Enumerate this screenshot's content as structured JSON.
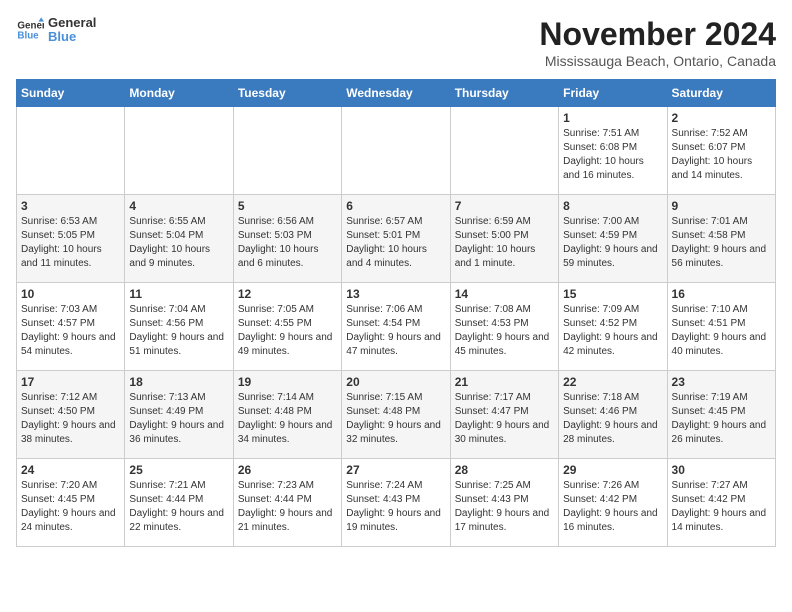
{
  "header": {
    "logo_line1": "General",
    "logo_line2": "Blue",
    "month": "November 2024",
    "location": "Mississauga Beach, Ontario, Canada"
  },
  "days_of_week": [
    "Sunday",
    "Monday",
    "Tuesday",
    "Wednesday",
    "Thursday",
    "Friday",
    "Saturday"
  ],
  "weeks": [
    [
      {
        "day": "",
        "info": ""
      },
      {
        "day": "",
        "info": ""
      },
      {
        "day": "",
        "info": ""
      },
      {
        "day": "",
        "info": ""
      },
      {
        "day": "",
        "info": ""
      },
      {
        "day": "1",
        "info": "Sunrise: 7:51 AM\nSunset: 6:08 PM\nDaylight: 10 hours and 16 minutes."
      },
      {
        "day": "2",
        "info": "Sunrise: 7:52 AM\nSunset: 6:07 PM\nDaylight: 10 hours and 14 minutes."
      }
    ],
    [
      {
        "day": "3",
        "info": "Sunrise: 6:53 AM\nSunset: 5:05 PM\nDaylight: 10 hours and 11 minutes."
      },
      {
        "day": "4",
        "info": "Sunrise: 6:55 AM\nSunset: 5:04 PM\nDaylight: 10 hours and 9 minutes."
      },
      {
        "day": "5",
        "info": "Sunrise: 6:56 AM\nSunset: 5:03 PM\nDaylight: 10 hours and 6 minutes."
      },
      {
        "day": "6",
        "info": "Sunrise: 6:57 AM\nSunset: 5:01 PM\nDaylight: 10 hours and 4 minutes."
      },
      {
        "day": "7",
        "info": "Sunrise: 6:59 AM\nSunset: 5:00 PM\nDaylight: 10 hours and 1 minute."
      },
      {
        "day": "8",
        "info": "Sunrise: 7:00 AM\nSunset: 4:59 PM\nDaylight: 9 hours and 59 minutes."
      },
      {
        "day": "9",
        "info": "Sunrise: 7:01 AM\nSunset: 4:58 PM\nDaylight: 9 hours and 56 minutes."
      }
    ],
    [
      {
        "day": "10",
        "info": "Sunrise: 7:03 AM\nSunset: 4:57 PM\nDaylight: 9 hours and 54 minutes."
      },
      {
        "day": "11",
        "info": "Sunrise: 7:04 AM\nSunset: 4:56 PM\nDaylight: 9 hours and 51 minutes."
      },
      {
        "day": "12",
        "info": "Sunrise: 7:05 AM\nSunset: 4:55 PM\nDaylight: 9 hours and 49 minutes."
      },
      {
        "day": "13",
        "info": "Sunrise: 7:06 AM\nSunset: 4:54 PM\nDaylight: 9 hours and 47 minutes."
      },
      {
        "day": "14",
        "info": "Sunrise: 7:08 AM\nSunset: 4:53 PM\nDaylight: 9 hours and 45 minutes."
      },
      {
        "day": "15",
        "info": "Sunrise: 7:09 AM\nSunset: 4:52 PM\nDaylight: 9 hours and 42 minutes."
      },
      {
        "day": "16",
        "info": "Sunrise: 7:10 AM\nSunset: 4:51 PM\nDaylight: 9 hours and 40 minutes."
      }
    ],
    [
      {
        "day": "17",
        "info": "Sunrise: 7:12 AM\nSunset: 4:50 PM\nDaylight: 9 hours and 38 minutes."
      },
      {
        "day": "18",
        "info": "Sunrise: 7:13 AM\nSunset: 4:49 PM\nDaylight: 9 hours and 36 minutes."
      },
      {
        "day": "19",
        "info": "Sunrise: 7:14 AM\nSunset: 4:48 PM\nDaylight: 9 hours and 34 minutes."
      },
      {
        "day": "20",
        "info": "Sunrise: 7:15 AM\nSunset: 4:48 PM\nDaylight: 9 hours and 32 minutes."
      },
      {
        "day": "21",
        "info": "Sunrise: 7:17 AM\nSunset: 4:47 PM\nDaylight: 9 hours and 30 minutes."
      },
      {
        "day": "22",
        "info": "Sunrise: 7:18 AM\nSunset: 4:46 PM\nDaylight: 9 hours and 28 minutes."
      },
      {
        "day": "23",
        "info": "Sunrise: 7:19 AM\nSunset: 4:45 PM\nDaylight: 9 hours and 26 minutes."
      }
    ],
    [
      {
        "day": "24",
        "info": "Sunrise: 7:20 AM\nSunset: 4:45 PM\nDaylight: 9 hours and 24 minutes."
      },
      {
        "day": "25",
        "info": "Sunrise: 7:21 AM\nSunset: 4:44 PM\nDaylight: 9 hours and 22 minutes."
      },
      {
        "day": "26",
        "info": "Sunrise: 7:23 AM\nSunset: 4:44 PM\nDaylight: 9 hours and 21 minutes."
      },
      {
        "day": "27",
        "info": "Sunrise: 7:24 AM\nSunset: 4:43 PM\nDaylight: 9 hours and 19 minutes."
      },
      {
        "day": "28",
        "info": "Sunrise: 7:25 AM\nSunset: 4:43 PM\nDaylight: 9 hours and 17 minutes."
      },
      {
        "day": "29",
        "info": "Sunrise: 7:26 AM\nSunset: 4:42 PM\nDaylight: 9 hours and 16 minutes."
      },
      {
        "day": "30",
        "info": "Sunrise: 7:27 AM\nSunset: 4:42 PM\nDaylight: 9 hours and 14 minutes."
      }
    ]
  ]
}
